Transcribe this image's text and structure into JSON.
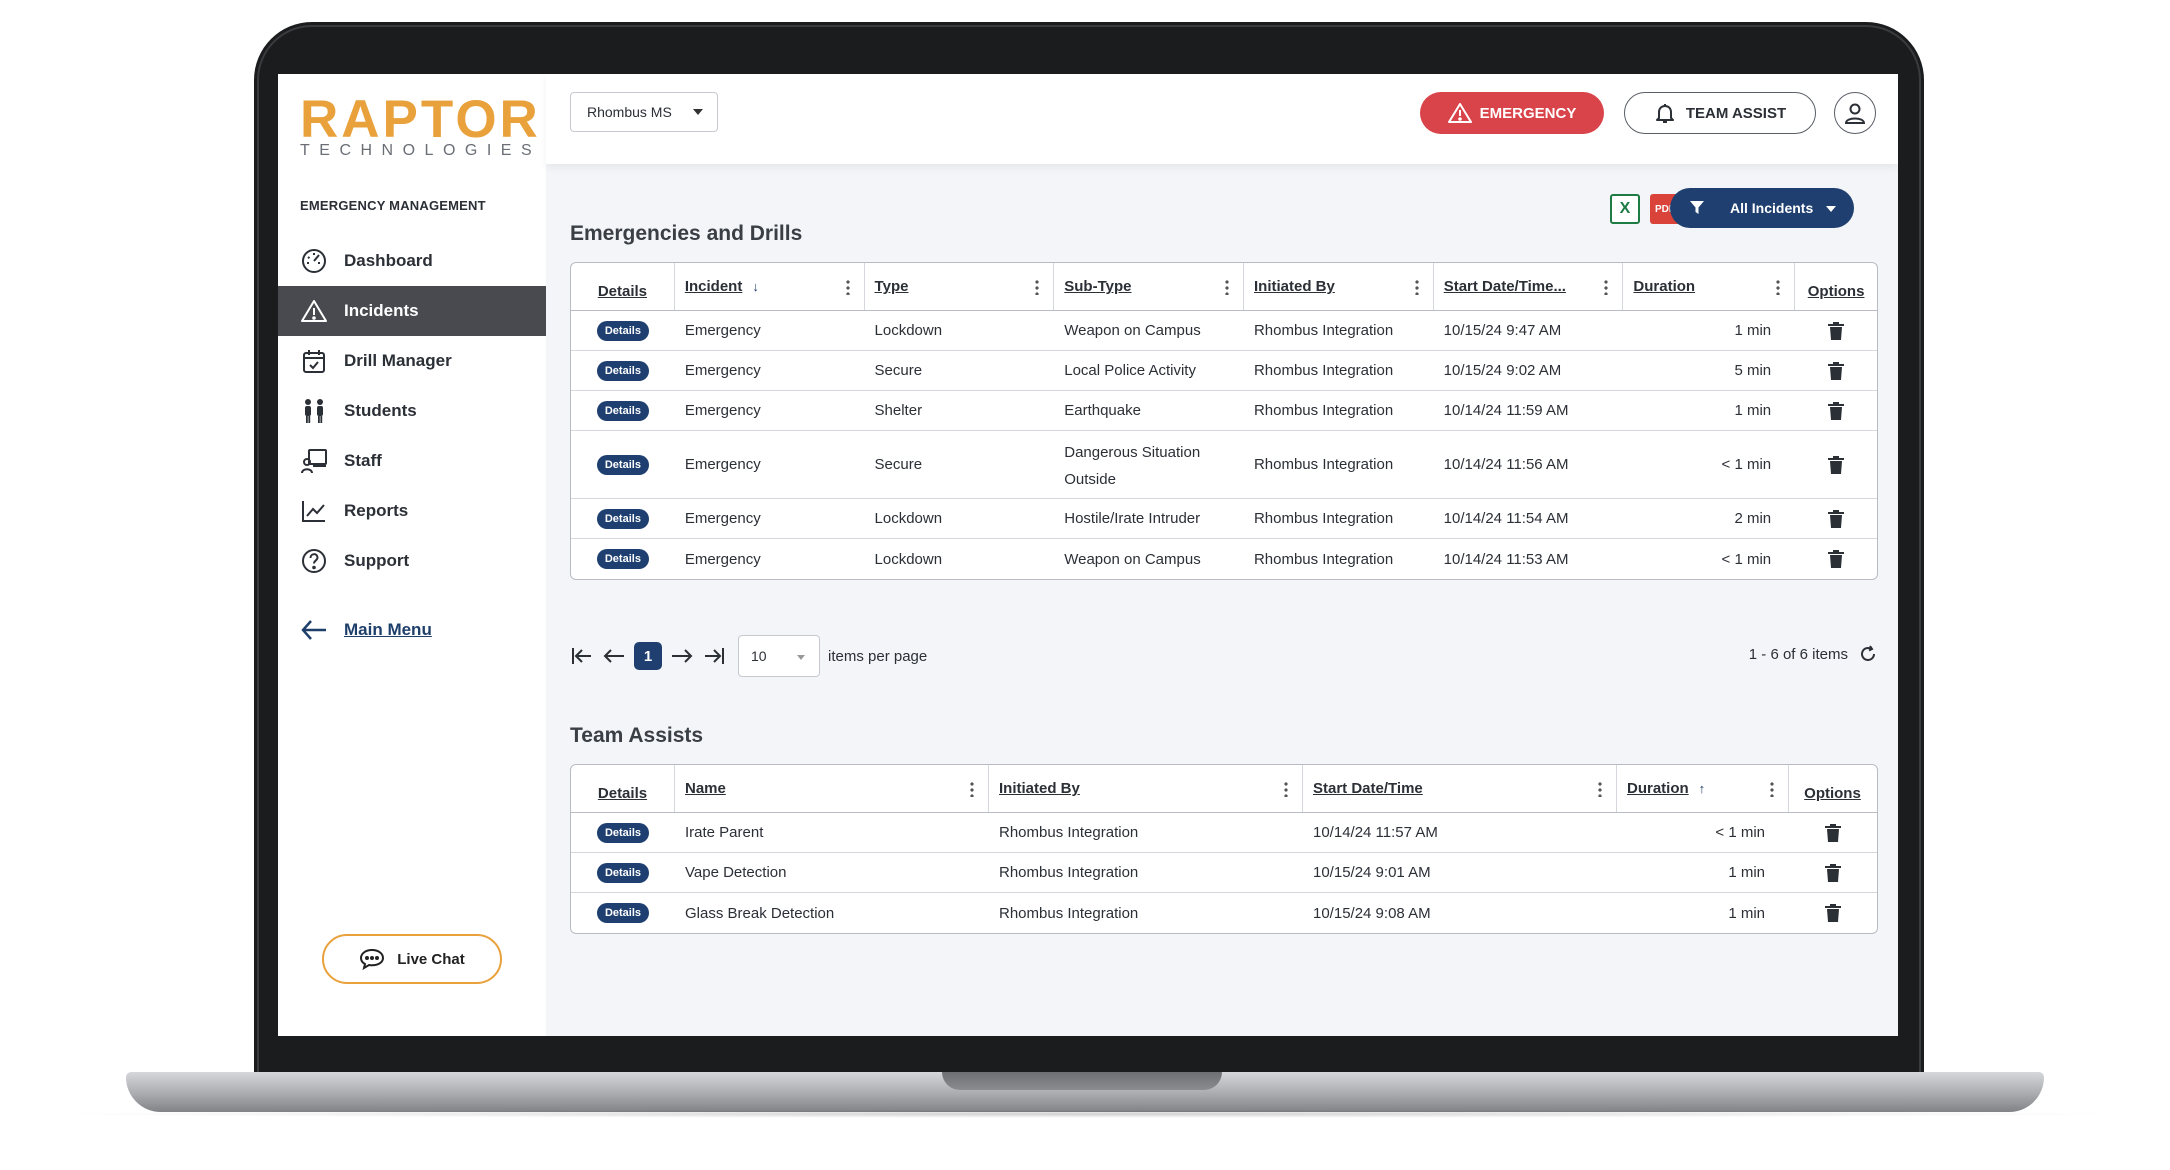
{
  "logo": {
    "main": "RAPTOR",
    "sub": "TECHNOLOGIES"
  },
  "sidebar": {
    "section_title": "EMERGENCY MANAGEMENT",
    "items": [
      {
        "label": "Dashboard",
        "icon": "dashboard-icon"
      },
      {
        "label": "Incidents",
        "icon": "warning-icon",
        "active": true
      },
      {
        "label": "Drill Manager",
        "icon": "calendar-check-icon"
      },
      {
        "label": "Students",
        "icon": "students-icon"
      },
      {
        "label": "Staff",
        "icon": "staff-icon"
      },
      {
        "label": "Reports",
        "icon": "chart-line-icon"
      },
      {
        "label": "Support",
        "icon": "help-circle-icon"
      }
    ],
    "main_menu": "Main Menu",
    "live_chat": "Live Chat"
  },
  "header": {
    "school": "Rhombus MS",
    "emergency": "EMERGENCY",
    "team_assist": "TEAM ASSIST"
  },
  "incidents": {
    "heading": "Emergencies and Drills",
    "filter": "All Incidents",
    "export_excel": "X",
    "export_pdf": "PDF",
    "columns": [
      "Details",
      "Incident",
      "Type",
      "Sub-Type",
      "Initiated By",
      "Start Date/Time...",
      "Duration",
      "Options"
    ],
    "details_label": "Details",
    "rows": [
      {
        "incident": "Emergency",
        "type": "Lockdown",
        "subtype": "Weapon on Campus",
        "initiated_by": "Rhombus Integration",
        "start": "10/15/24 9:47 AM",
        "duration": "1 min"
      },
      {
        "incident": "Emergency",
        "type": "Secure",
        "subtype": "Local Police Activity",
        "initiated_by": "Rhombus Integration",
        "start": "10/15/24 9:02 AM",
        "duration": "5 min"
      },
      {
        "incident": "Emergency",
        "type": "Shelter",
        "subtype": "Earthquake",
        "initiated_by": "Rhombus Integration",
        "start": "10/14/24 11:59 AM",
        "duration": "1 min"
      },
      {
        "incident": "Emergency",
        "type": "Secure",
        "subtype": "Dangerous Situation Outside",
        "initiated_by": "Rhombus Integration",
        "start": "10/14/24 11:56 AM",
        "duration": "< 1 min"
      },
      {
        "incident": "Emergency",
        "type": "Lockdown",
        "subtype": "Hostile/Irate Intruder",
        "initiated_by": "Rhombus Integration",
        "start": "10/14/24 11:54 AM",
        "duration": "2 min"
      },
      {
        "incident": "Emergency",
        "type": "Lockdown",
        "subtype": "Weapon on Campus",
        "initiated_by": "Rhombus Integration",
        "start": "10/14/24 11:53 AM",
        "duration": "< 1 min"
      }
    ],
    "pager": {
      "page": "1",
      "per_page": "10",
      "per_page_label": "items per page",
      "summary": "1 - 6 of 6 items"
    }
  },
  "team_assists": {
    "heading": "Team Assists",
    "columns": [
      "Details",
      "Name",
      "Initiated By",
      "Start Date/Time",
      "Duration",
      "Options"
    ],
    "details_label": "Details",
    "rows": [
      {
        "name": "Irate Parent",
        "initiated_by": "Rhombus Integration",
        "start": "10/14/24 11:57 AM",
        "duration": "< 1 min"
      },
      {
        "name": "Vape Detection",
        "initiated_by": "Rhombus Integration",
        "start": "10/15/24 9:01 AM",
        "duration": "1 min"
      },
      {
        "name": "Glass Break Detection",
        "initiated_by": "Rhombus Integration",
        "start": "10/15/24 9:08 AM",
        "duration": "1 min"
      }
    ]
  },
  "colors": {
    "brand": "#e9a13b",
    "navy": "#1e3f70",
    "danger": "#d9434a",
    "active_nav": "#484a4f"
  }
}
